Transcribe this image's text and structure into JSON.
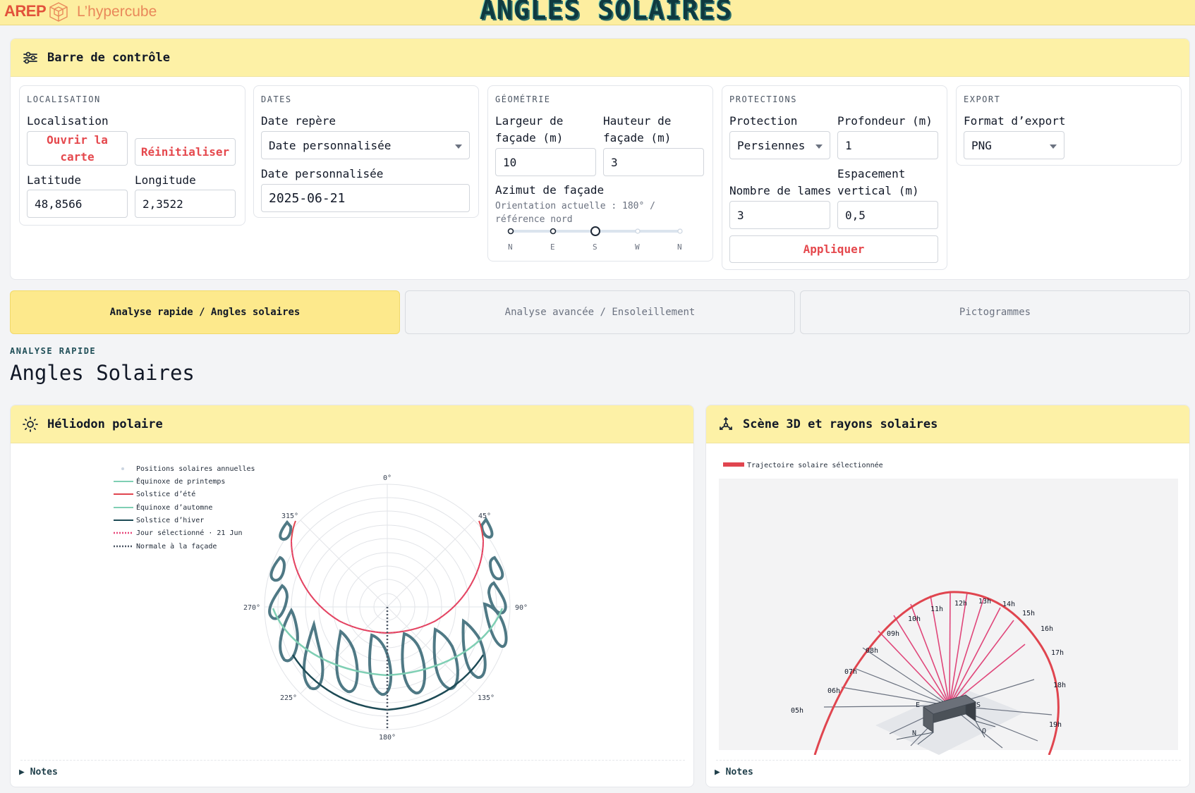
{
  "header": {
    "brand": "AREP",
    "brand_sub": "L’hypercube",
    "title": "ANGLES SOLAIRES"
  },
  "control_bar": {
    "title": "Barre de contrôle",
    "localisation": {
      "section": "LOCALISATION",
      "label": "Localisation",
      "open_map": "Ouvrir la carte",
      "reset": "Réinitialiser",
      "lat_label": "Latitude",
      "lat_value": "48,8566",
      "lon_label": "Longitude",
      "lon_value": "2,3522"
    },
    "dates": {
      "section": "DATES",
      "ref_label": "Date repère",
      "ref_value": "Date personnalisée",
      "custom_label": "Date personnalisée",
      "custom_value": "2025-06-21"
    },
    "geometry": {
      "section": "GÉOMÉTRIE",
      "width_label": "Largeur de façade (m)",
      "width_value": "10",
      "height_label": "Hauteur de façade (m)",
      "height_value": "3",
      "azimuth_label": "Azimut de façade",
      "azimuth_note": "Orientation actuelle : 180° / référence nord",
      "azimuth_value_deg": 180,
      "slider_ticks": [
        "N",
        "E",
        "S",
        "W",
        "N"
      ]
    },
    "protections": {
      "section": "PROTECTIONS",
      "protection_label": "Protection",
      "protection_value": "Persiennes",
      "depth_label": "Profondeur (m)",
      "depth_value": "1",
      "slats_label": "Nombre de lames",
      "slats_value": "3",
      "spacing_label": "Espacement vertical (m)",
      "spacing_value": "0,5",
      "apply": "Appliquer"
    },
    "export": {
      "section": "EXPORT",
      "format_label": "Format d’export",
      "format_value": "PNG"
    }
  },
  "tabs": [
    {
      "label": "Analyse rapide / Angles solaires",
      "active": true
    },
    {
      "label": "Analyse avancée / Ensoleillement",
      "active": false
    },
    {
      "label": "Pictogrammes",
      "active": false
    }
  ],
  "main": {
    "eyebrow": "ANALYSE RAPIDE",
    "heading": "Angles Solaires"
  },
  "heliodon": {
    "title": "Héliodon polaire",
    "notes": "Notes",
    "legend": [
      {
        "label": "Positions solaires annuelles",
        "color": "#cbd5e1",
        "style": "dot"
      },
      {
        "label": "Équinoxe de printemps",
        "color": "#7fcfb4",
        "style": "solid"
      },
      {
        "label": "Solstice d’été",
        "color": "#e0454f",
        "style": "solid"
      },
      {
        "label": "Équinoxe d’automne",
        "color": "#7fcfb4",
        "style": "solid"
      },
      {
        "label": "Solstice d’hiver",
        "color": "#1d4a55",
        "style": "solid"
      },
      {
        "label": "Jour sélectionné · 21 Jun",
        "color": "#e8477a",
        "style": "dotted"
      },
      {
        "label": "Normale à la façade",
        "color": "#4b5563",
        "style": "dotted"
      }
    ],
    "angular_ticks": [
      "0°",
      "45°",
      "90°",
      "135°",
      "180°",
      "225°",
      "270°",
      "315°"
    ]
  },
  "scene3d": {
    "title": "Scène 3D et rayons solaires",
    "notes": "Notes",
    "legend": "Trajectoire solaire sélectionnée",
    "hours": [
      "05h",
      "06h",
      "07h",
      "08h",
      "09h",
      "10h",
      "11h",
      "12h",
      "13h",
      "14h",
      "15h",
      "16h",
      "17h",
      "18h",
      "19h"
    ],
    "compass": [
      "N",
      "E",
      "S",
      "O"
    ]
  },
  "colors": {
    "accent_yellow": "#fde98c",
    "accent_red": "#e5484d",
    "teal_dark": "#1d4a55",
    "teal_light": "#7fcfb4",
    "ray_pink": "#e0467a"
  }
}
